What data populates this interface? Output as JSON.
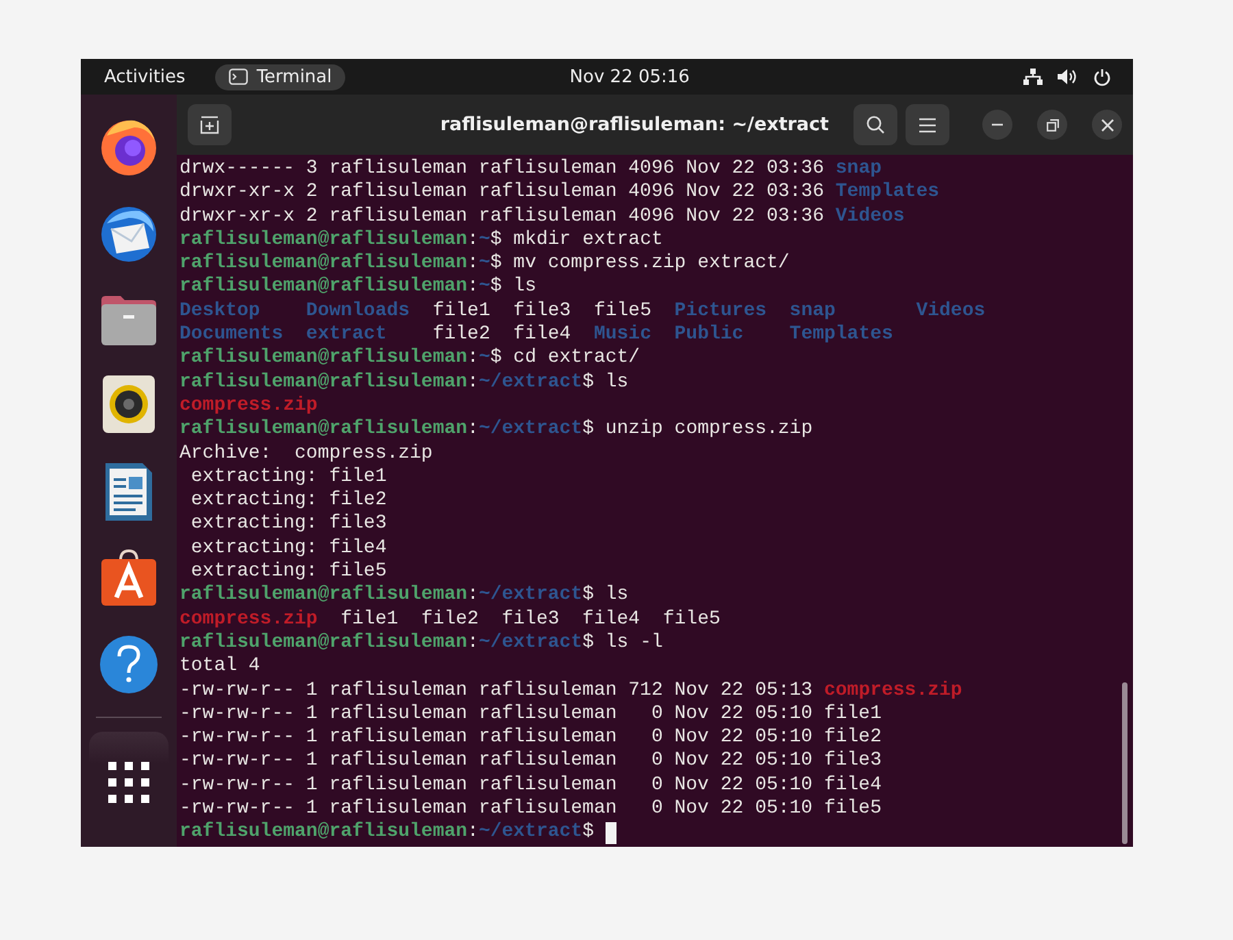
{
  "top_bar": {
    "activities": "Activities",
    "app_label": "Terminal",
    "clock": "Nov 22  05:16"
  },
  "window": {
    "title": "raflisuleman@raflisuleman: ~/extract"
  },
  "terminal": {
    "cursor": true,
    "lines": [
      {
        "segments": [
          {
            "kind": "plain",
            "text": "drwx------ 3 raflisuleman raflisuleman 4096 Nov 22 03:36 "
          },
          {
            "kind": "dir",
            "text": "snap"
          }
        ]
      },
      {
        "segments": [
          {
            "kind": "plain",
            "text": "drwxr-xr-x 2 raflisuleman raflisuleman 4096 Nov 22 03:36 "
          },
          {
            "kind": "dir",
            "text": "Templates"
          }
        ]
      },
      {
        "segments": [
          {
            "kind": "plain",
            "text": "drwxr-xr-x 2 raflisuleman raflisuleman 4096 Nov 22 03:36 "
          },
          {
            "kind": "dir",
            "text": "Videos"
          }
        ]
      },
      {
        "segments": [
          {
            "kind": "user",
            "text": "raflisuleman@raflisuleman"
          },
          {
            "kind": "plain",
            "text": ":"
          },
          {
            "kind": "path",
            "text": "~"
          },
          {
            "kind": "plain",
            "text": "$ mkdir extract"
          }
        ]
      },
      {
        "segments": [
          {
            "kind": "user",
            "text": "raflisuleman@raflisuleman"
          },
          {
            "kind": "plain",
            "text": ":"
          },
          {
            "kind": "path",
            "text": "~"
          },
          {
            "kind": "plain",
            "text": "$ mv compress.zip extract/"
          }
        ]
      },
      {
        "segments": [
          {
            "kind": "user",
            "text": "raflisuleman@raflisuleman"
          },
          {
            "kind": "plain",
            "text": ":"
          },
          {
            "kind": "path",
            "text": "~"
          },
          {
            "kind": "plain",
            "text": "$ ls"
          }
        ]
      },
      {
        "segments": [
          {
            "kind": "dir",
            "text": "Desktop    "
          },
          {
            "kind": "dir",
            "text": "Downloads"
          },
          {
            "kind": "plain",
            "text": "  file1  file3  file5  "
          },
          {
            "kind": "dir",
            "text": "Pictures  "
          },
          {
            "kind": "dir",
            "text": "snap       "
          },
          {
            "kind": "dir",
            "text": "Videos"
          }
        ]
      },
      {
        "segments": [
          {
            "kind": "dir",
            "text": "Documents  "
          },
          {
            "kind": "dir",
            "text": "extract"
          },
          {
            "kind": "plain",
            "text": "    file2  file4  "
          },
          {
            "kind": "dir",
            "text": "Music  "
          },
          {
            "kind": "dir",
            "text": "Public    "
          },
          {
            "kind": "dir",
            "text": "Templates"
          }
        ]
      },
      {
        "segments": [
          {
            "kind": "user",
            "text": "raflisuleman@raflisuleman"
          },
          {
            "kind": "plain",
            "text": ":"
          },
          {
            "kind": "path",
            "text": "~"
          },
          {
            "kind": "plain",
            "text": "$ cd extract/"
          }
        ]
      },
      {
        "segments": [
          {
            "kind": "user",
            "text": "raflisuleman@raflisuleman"
          },
          {
            "kind": "plain",
            "text": ":"
          },
          {
            "kind": "path",
            "text": "~/extract"
          },
          {
            "kind": "plain",
            "text": "$ ls"
          }
        ]
      },
      {
        "segments": [
          {
            "kind": "archive",
            "text": "compress.zip"
          }
        ]
      },
      {
        "segments": [
          {
            "kind": "user",
            "text": "raflisuleman@raflisuleman"
          },
          {
            "kind": "plain",
            "text": ":"
          },
          {
            "kind": "path",
            "text": "~/extract"
          },
          {
            "kind": "plain",
            "text": "$ unzip compress.zip"
          }
        ]
      },
      {
        "segments": [
          {
            "kind": "plain",
            "text": "Archive:  compress.zip"
          }
        ]
      },
      {
        "segments": [
          {
            "kind": "plain",
            "text": " extracting: file1"
          }
        ]
      },
      {
        "segments": [
          {
            "kind": "plain",
            "text": " extracting: file2"
          }
        ]
      },
      {
        "segments": [
          {
            "kind": "plain",
            "text": " extracting: file3"
          }
        ]
      },
      {
        "segments": [
          {
            "kind": "plain",
            "text": " extracting: file4"
          }
        ]
      },
      {
        "segments": [
          {
            "kind": "plain",
            "text": " extracting: file5"
          }
        ]
      },
      {
        "segments": [
          {
            "kind": "user",
            "text": "raflisuleman@raflisuleman"
          },
          {
            "kind": "plain",
            "text": ":"
          },
          {
            "kind": "path",
            "text": "~/extract"
          },
          {
            "kind": "plain",
            "text": "$ ls"
          }
        ]
      },
      {
        "segments": [
          {
            "kind": "archive",
            "text": "compress.zip"
          },
          {
            "kind": "plain",
            "text": "  file1  file2  file3  file4  file5"
          }
        ]
      },
      {
        "segments": [
          {
            "kind": "user",
            "text": "raflisuleman@raflisuleman"
          },
          {
            "kind": "plain",
            "text": ":"
          },
          {
            "kind": "path",
            "text": "~/extract"
          },
          {
            "kind": "plain",
            "text": "$ ls -l"
          }
        ]
      },
      {
        "segments": [
          {
            "kind": "plain",
            "text": "total 4"
          }
        ]
      },
      {
        "segments": [
          {
            "kind": "plain",
            "text": "-rw-rw-r-- 1 raflisuleman raflisuleman 712 Nov 22 05:13 "
          },
          {
            "kind": "archive",
            "text": "compress.zip"
          }
        ]
      },
      {
        "segments": [
          {
            "kind": "plain",
            "text": "-rw-rw-r-- 1 raflisuleman raflisuleman   0 Nov 22 05:10 file1"
          }
        ]
      },
      {
        "segments": [
          {
            "kind": "plain",
            "text": "-rw-rw-r-- 1 raflisuleman raflisuleman   0 Nov 22 05:10 file2"
          }
        ]
      },
      {
        "segments": [
          {
            "kind": "plain",
            "text": "-rw-rw-r-- 1 raflisuleman raflisuleman   0 Nov 22 05:10 file3"
          }
        ]
      },
      {
        "segments": [
          {
            "kind": "plain",
            "text": "-rw-rw-r-- 1 raflisuleman raflisuleman   0 Nov 22 05:10 file4"
          }
        ]
      },
      {
        "segments": [
          {
            "kind": "plain",
            "text": "-rw-rw-r-- 1 raflisuleman raflisuleman   0 Nov 22 05:10 file5"
          }
        ]
      },
      {
        "segments": [
          {
            "kind": "user",
            "text": "raflisuleman@raflisuleman"
          },
          {
            "kind": "plain",
            "text": ":"
          },
          {
            "kind": "path",
            "text": "~/extract"
          },
          {
            "kind": "plain",
            "text": "$ "
          }
        ]
      }
    ]
  }
}
